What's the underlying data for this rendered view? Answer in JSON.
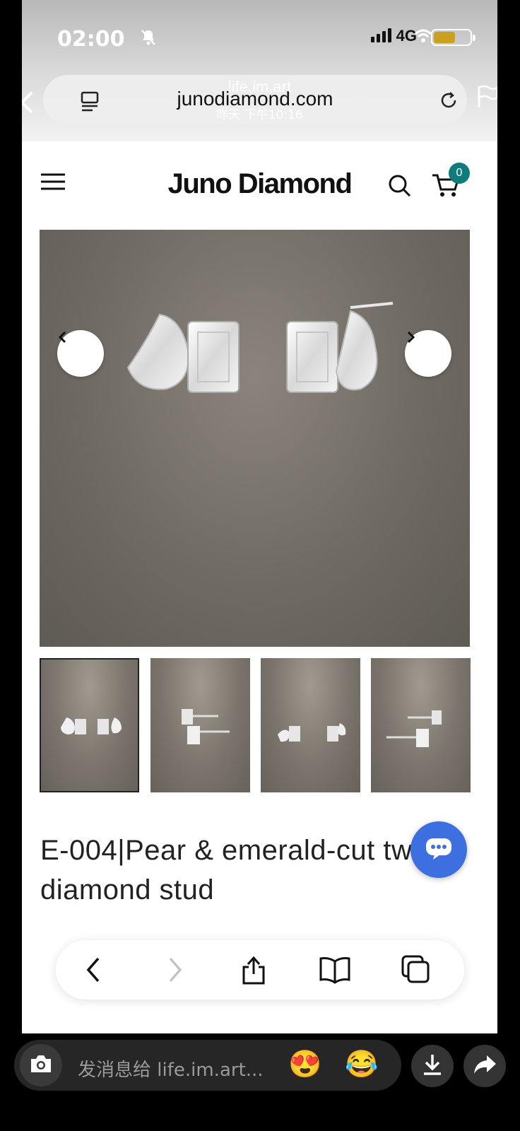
{
  "status_bar": {
    "time": "02:00",
    "network": "4G",
    "battery_level": 0.6
  },
  "browser": {
    "url": "junodiamond.com"
  },
  "story_overlay": {
    "account": "life.im.art",
    "timestamp": "昨天 下午10:16"
  },
  "site_header": {
    "brand": "Juno Diamond",
    "cart_count": "0"
  },
  "gallery": {
    "thumbnail_count": 4,
    "active_index": 0
  },
  "product": {
    "title_line1": "E-004|Pear & emerald-cut two",
    "title_line2": "diamond stud"
  },
  "reply_bar": {
    "placeholder": "发消息给 life.im.art...",
    "emoji_1": "😍",
    "emoji_2": "😂"
  },
  "colors": {
    "cart_badge": "#0f7c7b",
    "chat_button": "#3d6fe0",
    "battery": "#c9a11f"
  }
}
